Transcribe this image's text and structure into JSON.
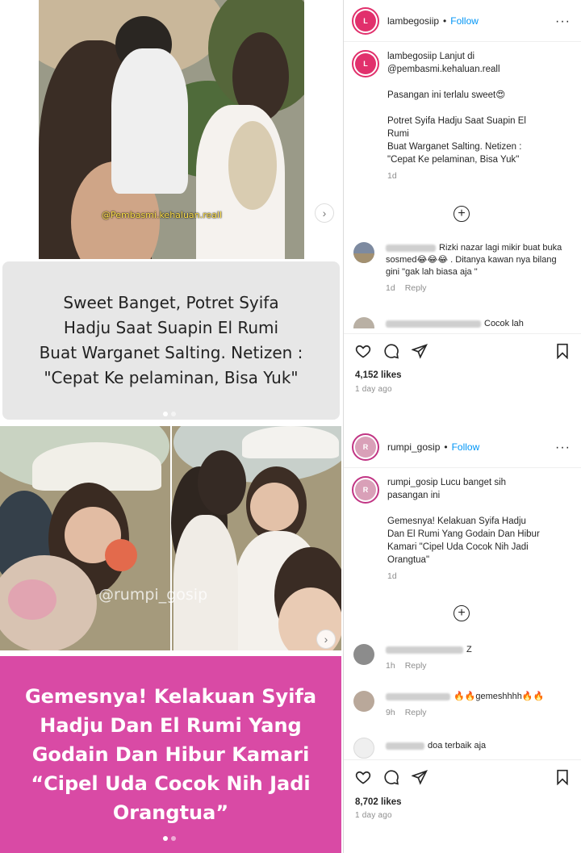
{
  "posts": [
    {
      "media": {
        "watermark": "@Pembasmi.kehaluan.reall",
        "caption": [
          "Sweet Banget, Potret Syifa",
          "Hadju Saat Suapin El Rumi",
          "Buat Warganet Salting. Netizen :",
          "\"Cepat Ke pelaminan, Bisa Yuk\""
        ],
        "caption_bg": "#e7e7e7",
        "caption_color": "#222222",
        "next_icon": "chevron-right-icon"
      },
      "header": {
        "username": "lambegosiip",
        "separator": "•",
        "follow": "Follow",
        "more": "···"
      },
      "caption": {
        "username": "lambegosiip",
        "first_line": "Lanjut di",
        "line2": "@pembasmi.kehaluan.reall",
        "line3": "Pasangan ini terlalu sweet😍",
        "line4": "Potret Syifa Hadju Saat Suapin El",
        "line5": "Rumi",
        "line6": "Buat Warganet Salting. Netizen :",
        "line7": "\"Cepat Ke pelaminan, Bisa Yuk\"",
        "time": "1d"
      },
      "comments": [
        {
          "text": "Rizki nazar lagi mikir buat buka sosmed😂😂😂 . Ditanya kawan nya bilang gini \"gak lah biasa aja \"",
          "time": "1d",
          "reply": "Reply"
        },
        {
          "text": "Cocok lah",
          "time": "",
          "reply": ""
        }
      ],
      "likes": "4,152 likes",
      "ago": "1 day ago"
    },
    {
      "media": {
        "watermark": "@rumpi_gosip",
        "caption": [
          "Gemesnya! Kelakuan Syifa",
          "Hadju Dan El Rumi Yang",
          "Godain Dan Hibur Kamari",
          "“Cipel Uda Cocok Nih Jadi",
          "Orangtua”"
        ],
        "caption_bg": "#d94aa5",
        "caption_color": "#ffffff",
        "next_icon": "chevron-right-icon"
      },
      "header": {
        "username": "rumpi_gosip",
        "separator": "•",
        "follow": "Follow",
        "more": "···"
      },
      "caption": {
        "username": "rumpi_gosip",
        "first_line": "Lucu banget sih",
        "line2": "pasangan ini",
        "line3": "Gemesnya! Kelakuan Syifa Hadju",
        "line4": "Dan El Rumi Yang Godain Dan Hibur",
        "line5": "Kamari \"Cipel Uda Cocok Nih Jadi",
        "line6": "Orangtua\"",
        "time": "1d"
      },
      "comments": [
        {
          "text": "Z",
          "time": "1h",
          "reply": "Reply"
        },
        {
          "text": "🔥🔥gemeshhhh🔥🔥",
          "time": "9h",
          "reply": "Reply"
        },
        {
          "text": "doa terbaik aja",
          "time": "",
          "reply": ""
        }
      ],
      "likes": "8,702 likes",
      "ago": "1 day ago"
    }
  ],
  "icons": {
    "heart": "heart-icon",
    "comment": "comment-icon",
    "share": "share-icon",
    "save": "bookmark-icon",
    "add_comment": "plus-circle-icon"
  },
  "colors": {
    "follow": "#0095f6",
    "muted": "#8e8e8e",
    "pink": "#d94aa5"
  }
}
